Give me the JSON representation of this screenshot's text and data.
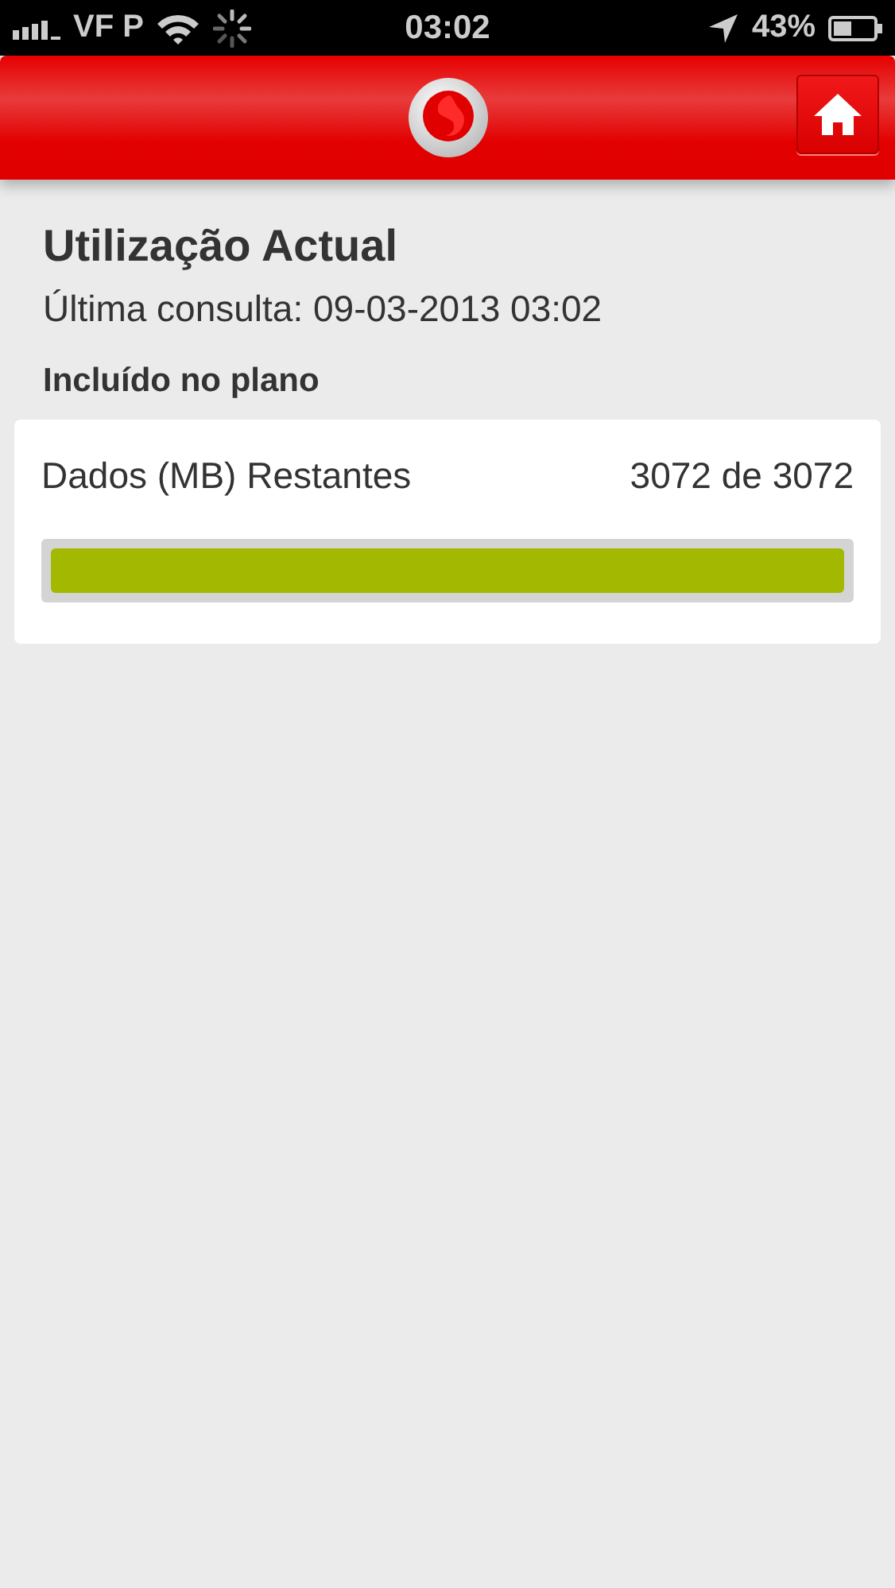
{
  "status_bar": {
    "carrier": "VF P",
    "time": "03:02",
    "battery": "43%"
  },
  "header": {
    "home_button": true
  },
  "title": "Utilização Actual",
  "last_check": "Última consulta: 09-03-2013 03:02",
  "section": "Incluído no plano",
  "meters": [
    {
      "name": "Dados (MB) Restantes",
      "reading": "3072 de 3072",
      "level": 1
    }
  ]
}
